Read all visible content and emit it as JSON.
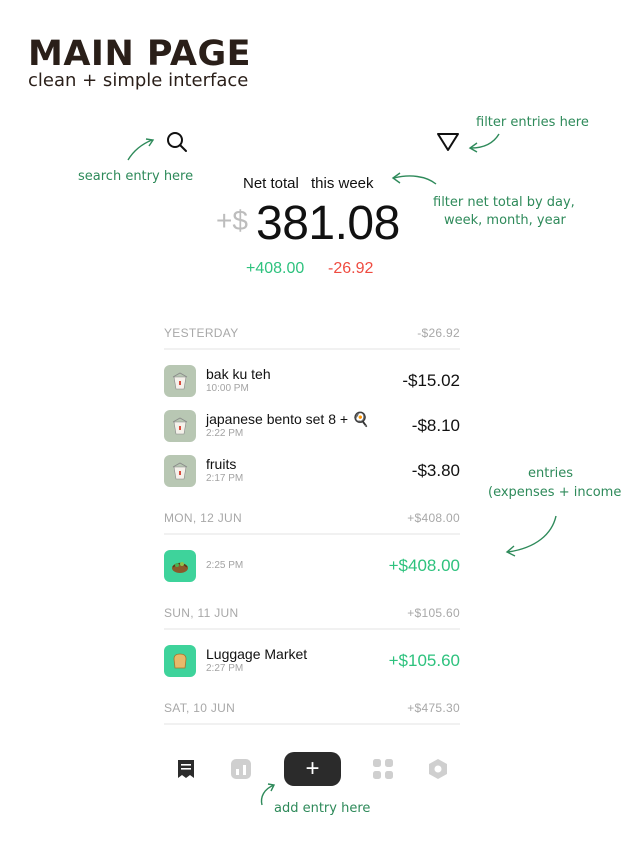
{
  "header": {
    "title": "MAIN PAGE",
    "subtitle": "clean + simple interface"
  },
  "annotations": {
    "search": "search entry here",
    "filter": "filter entries here",
    "period": [
      "filter net total by day,",
      "week, month, year"
    ],
    "entries": [
      "entries",
      "(expenses + income"
    ],
    "add": "add entry here"
  },
  "summary": {
    "label": "Net total",
    "period": "this week",
    "currency": "+$",
    "amount": "381.08",
    "income": "+408.00",
    "expense": "-26.92"
  },
  "sections": [
    {
      "label": "YESTERDAY",
      "total": "-$26.92",
      "entries": [
        {
          "name": "bak ku teh",
          "time": "10:00 PM",
          "amount": "-$15.02",
          "type": "expense",
          "icon": "takeout-box-icon"
        },
        {
          "name": "japanese bento set 8 + 🍳",
          "time": "2:22 PM",
          "amount": "-$8.10",
          "type": "expense",
          "icon": "takeout-box-icon"
        },
        {
          "name": "fruits",
          "time": "2:17 PM",
          "amount": "-$3.80",
          "type": "expense",
          "icon": "takeout-box-icon"
        }
      ]
    },
    {
      "label": "MON, 12 JUN",
      "total": "+$408.00",
      "entries": [
        {
          "name": "",
          "time": "2:25 PM",
          "amount": "+$408.00",
          "type": "income",
          "icon": "basket-icon"
        }
      ]
    },
    {
      "label": "SUN, 11 JUN",
      "total": "+$105.60",
      "entries": [
        {
          "name": "Luggage Market",
          "time": "2:27 PM",
          "amount": "+$105.60",
          "type": "income",
          "icon": "bread-icon"
        }
      ]
    },
    {
      "label": "SAT, 10 JUN",
      "total": "+$475.30",
      "entries": []
    }
  ],
  "nav": {
    "add_label": "+"
  },
  "colors": {
    "accent_green": "#2ec27e",
    "expense_red": "#ef4b40",
    "annotation_green": "#2e8a5a",
    "income_tile": "#3ed39b",
    "expense_tile": "#b8c7b3"
  }
}
